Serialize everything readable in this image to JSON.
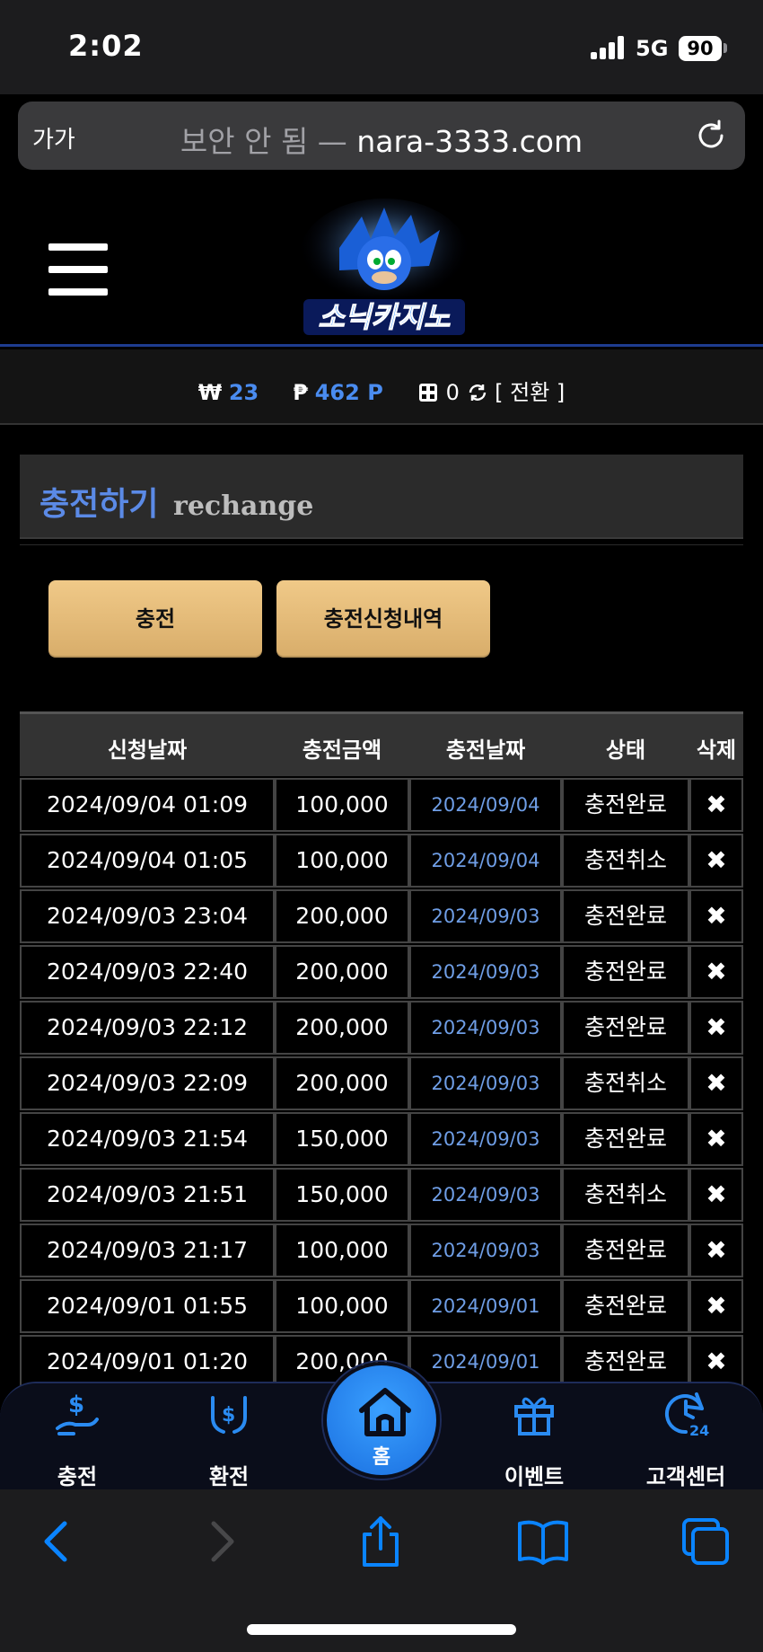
{
  "status_bar": {
    "time": "2:02",
    "network": "5G",
    "battery": "90"
  },
  "url_bar": {
    "aa": "가가",
    "security": "보안 안 됨 —",
    "domain": "nara-3333.com"
  },
  "header": {
    "logo_alt": "소닉카지노"
  },
  "balance": {
    "won_symbol": "₩",
    "won_value": "23",
    "point_symbol": "₱",
    "point_value": "462 P",
    "chip_value": "0",
    "convert_label": "[ 전환 ]"
  },
  "section": {
    "title": "충전하기",
    "subtitle": "rechange"
  },
  "buttons": {
    "charge": "충전",
    "history": "충전신청내역"
  },
  "table": {
    "headers": [
      "신청날짜",
      "충전금액",
      "충전날짜",
      "상태",
      "삭제"
    ],
    "rows": [
      {
        "req": "2024/09/04 01:09",
        "amount": "100,000",
        "date": "2024/09/04",
        "status": "충전완료",
        "del": "✖"
      },
      {
        "req": "2024/09/04 01:05",
        "amount": "100,000",
        "date": "2024/09/04",
        "status": "충전취소",
        "del": "✖"
      },
      {
        "req": "2024/09/03 23:04",
        "amount": "200,000",
        "date": "2024/09/03",
        "status": "충전완료",
        "del": "✖"
      },
      {
        "req": "2024/09/03 22:40",
        "amount": "200,000",
        "date": "2024/09/03",
        "status": "충전완료",
        "del": "✖"
      },
      {
        "req": "2024/09/03 22:12",
        "amount": "200,000",
        "date": "2024/09/03",
        "status": "충전완료",
        "del": "✖"
      },
      {
        "req": "2024/09/03 22:09",
        "amount": "200,000",
        "date": "2024/09/03",
        "status": "충전취소",
        "del": "✖"
      },
      {
        "req": "2024/09/03 21:54",
        "amount": "150,000",
        "date": "2024/09/03",
        "status": "충전완료",
        "del": "✖"
      },
      {
        "req": "2024/09/03 21:51",
        "amount": "150,000",
        "date": "2024/09/03",
        "status": "충전취소",
        "del": "✖"
      },
      {
        "req": "2024/09/03 21:17",
        "amount": "100,000",
        "date": "2024/09/03",
        "status": "충전완료",
        "del": "✖"
      },
      {
        "req": "2024/09/01 01:55",
        "amount": "100,000",
        "date": "2024/09/01",
        "status": "충전완료",
        "del": "✖"
      },
      {
        "req": "2024/09/01 01:20",
        "amount": "200,000",
        "date": "2024/09/01",
        "status": "충전완료",
        "del": "✖"
      }
    ]
  },
  "bottom_nav": {
    "items": [
      {
        "label": "충전",
        "icon": "hand-dollar-icon"
      },
      {
        "label": "환전",
        "icon": "exchange-hands-icon"
      },
      {
        "label": "홈",
        "icon": "home-icon"
      },
      {
        "label": "이벤트",
        "icon": "gift-icon"
      },
      {
        "label": "고객센터",
        "icon": "support-24-icon"
      }
    ]
  },
  "colors": {
    "accent_blue": "#4a8cf0",
    "gold": "#e3b877",
    "nav_blue": "#2a8bf2"
  }
}
